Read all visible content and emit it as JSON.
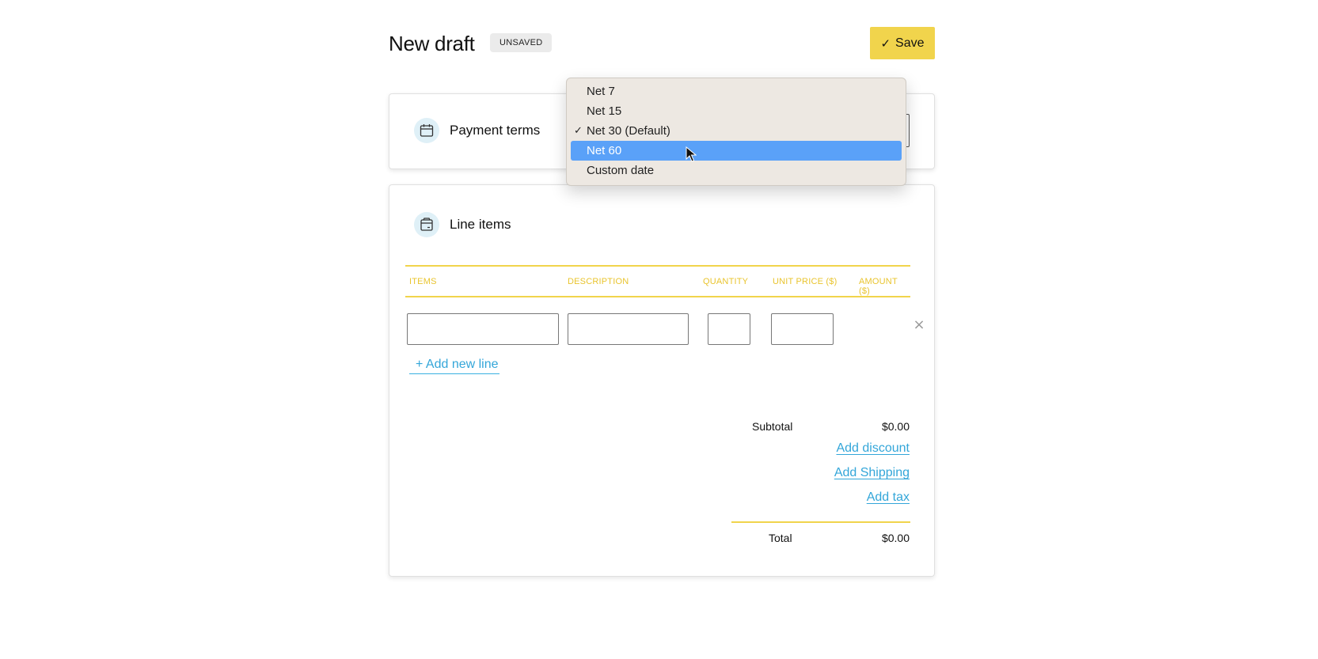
{
  "header": {
    "title": "New draft",
    "badge": "UNSAVED",
    "save_label": "Save",
    "save_icon": "✓"
  },
  "payment_terms": {
    "icon": "calendar-icon",
    "title": "Payment terms"
  },
  "dropdown": {
    "options": [
      {
        "label": "Net 7",
        "checked": false,
        "highlighted": false
      },
      {
        "label": "Net 15",
        "checked": false,
        "highlighted": false
      },
      {
        "label": "Net 30 (Default)",
        "checked": true,
        "highlighted": false
      },
      {
        "label": "Net 60",
        "checked": false,
        "highlighted": true
      },
      {
        "label": "Custom date",
        "checked": false,
        "highlighted": false
      }
    ],
    "check_glyph": "✓"
  },
  "line_items": {
    "icon": "box-icon",
    "title": "Line items",
    "columns": [
      "ITEMS",
      "DESCRIPTION",
      "QUANTITY",
      "UNIT PRICE ($)",
      "AMOUNT ($)"
    ],
    "rows": [
      {
        "item": "",
        "description": "",
        "quantity": "",
        "unit_price": "",
        "amount": ""
      }
    ],
    "remove_glyph": "×",
    "add_line_label": "+ Add new line"
  },
  "summary": {
    "subtotal_label": "Subtotal",
    "subtotal_value": "$0.00",
    "add_discount": "Add discount",
    "add_shipping": "Add Shipping",
    "add_tax": "Add tax",
    "total_label": "Total",
    "total_value": "$0.00"
  },
  "colors": {
    "accent_yellow": "#f1d44c",
    "link_blue": "#33a6d9",
    "selection_blue": "#5aa1f8",
    "icon_bg": "#dff0f7"
  }
}
